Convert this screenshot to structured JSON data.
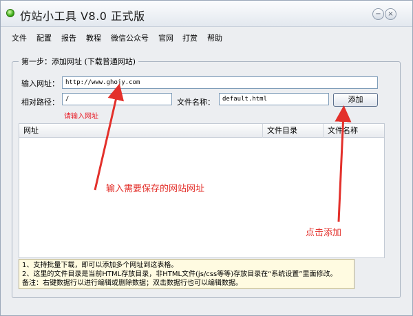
{
  "window": {
    "title": "仿站小工具 V8.0 正式版",
    "minimize_symbol": "−",
    "close_symbol": "×"
  },
  "menu": [
    "文件",
    "配置",
    "报告",
    "教程",
    "微信公众号",
    "官网",
    "打赏",
    "帮助"
  ],
  "step1": {
    "legend": "第一步：添加网址 (下载普通网站)",
    "url_label": "输入网址：",
    "url_value": "http://www.ghojy.com",
    "path_label": "相对路径：",
    "path_value": "/",
    "hint": "请输入网址",
    "filename_label": "文件名称：",
    "filename_value": "default.html",
    "add_button": "添加"
  },
  "table": {
    "columns": [
      "网址",
      "文件目录",
      "文件名称"
    ],
    "rows": []
  },
  "notes": [
    "1、支持批量下载，即可以添加多个网址到这表格。",
    "2、这里的文件目录是当前HTML存放目录，非HTML文件(js/css等等)存放目录在“系统设置”里面修改。",
    "备注：右键数据行以进行编辑或删除数据；双击数据行也可以编辑数据。"
  ],
  "annotations": {
    "input_hint": "输入需要保存的网站网址",
    "click_hint": "点击添加"
  },
  "colors": {
    "annotation_red": "#e3302b",
    "hint_red": "#e8202a"
  }
}
